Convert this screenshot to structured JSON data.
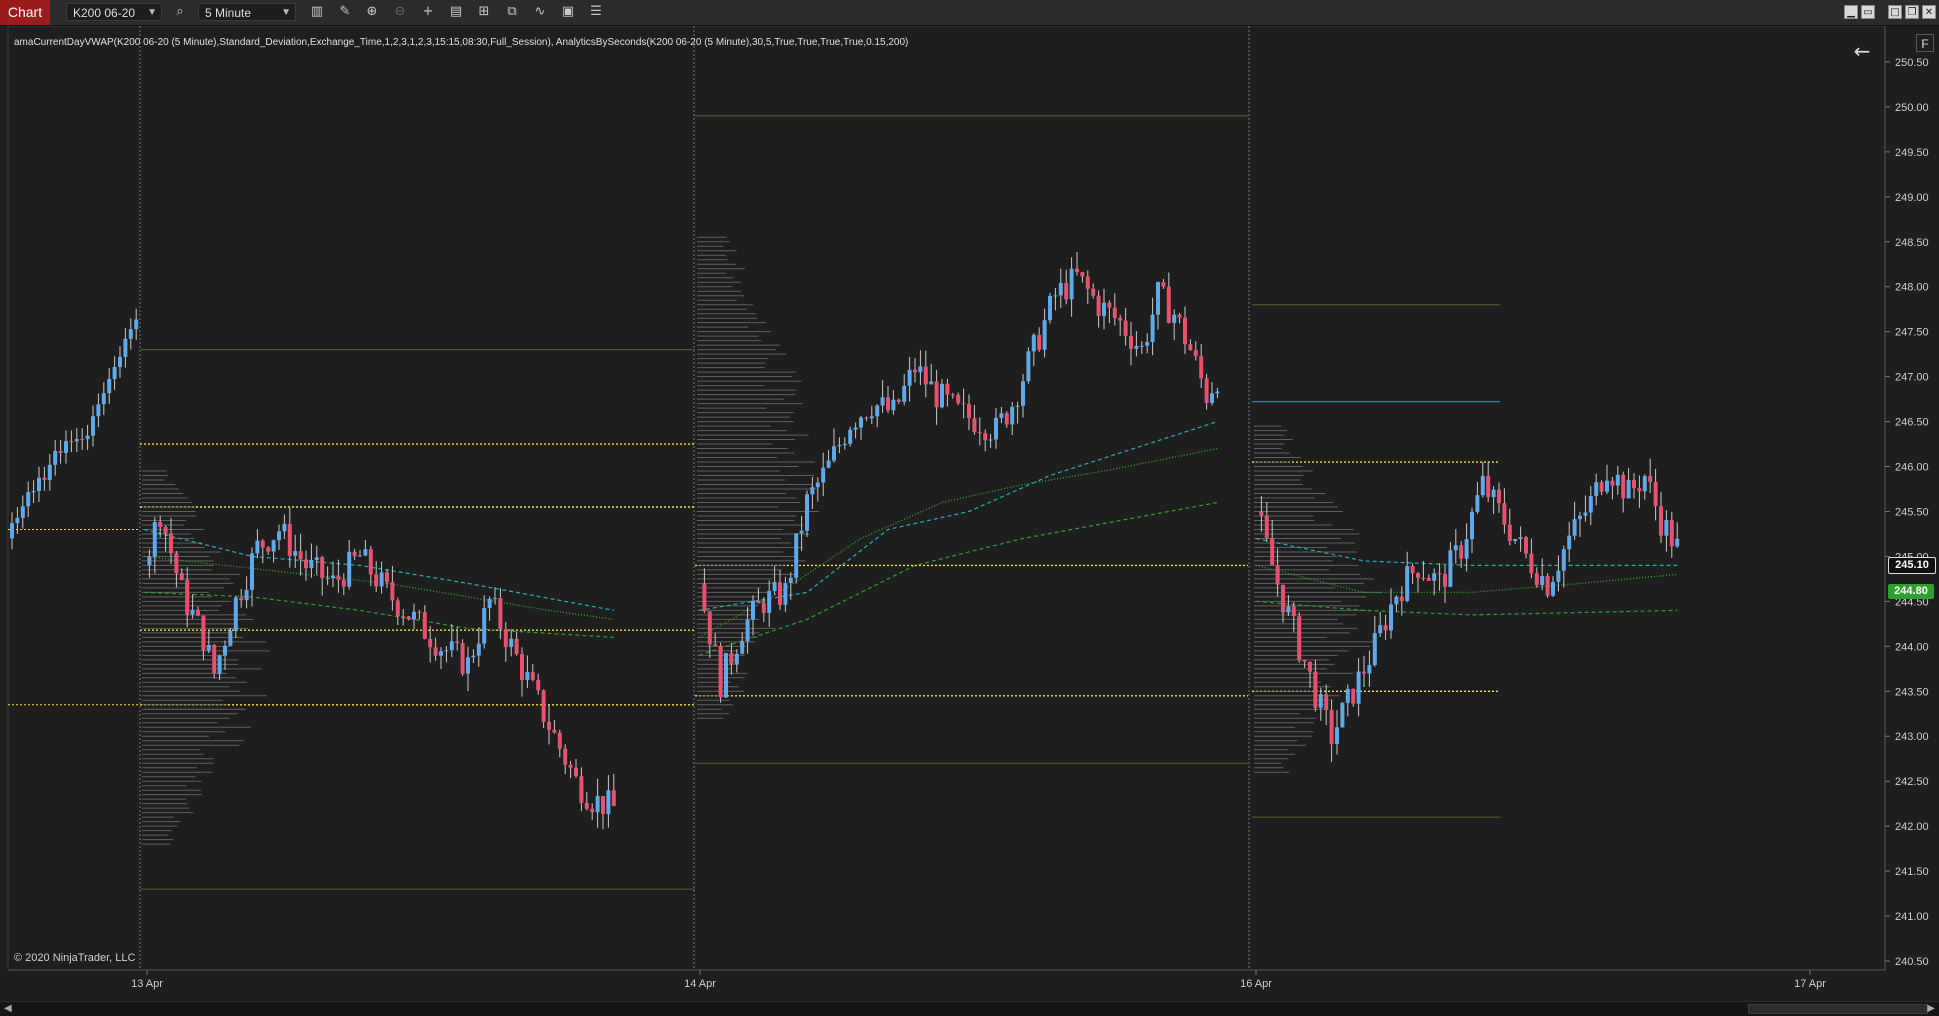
{
  "toolbar": {
    "tab_label": "Chart",
    "instrument": "K200 06-20",
    "interval": "5 Minute",
    "icons": [
      "search-icon",
      "bar-type-icon",
      "draw-pencil-icon",
      "zoom-in-icon",
      "zoom-out-icon",
      "crosshair-icon",
      "properties-icon",
      "data-box-icon",
      "strategy-icon",
      "indicators-icon",
      "templates-icon",
      "list-icon"
    ],
    "window_controls": [
      "minimize-icon",
      "restore-icon",
      "maximize-icon",
      "close-icon"
    ]
  },
  "indicator_label": "amaCurrentDayVWAP(K200 06-20 (5 Minute),Standard_Deviation,Exchange_Time,1,2,3,1,2,3,15:15,08:30,Full_Session), AnalyticsBySeconds(K200 06-20 (5 Minute),30,5,True,True,True,True,0.15,200)",
  "copyright": "© 2020 NinjaTrader, LLC",
  "f_button": "F",
  "colors": {
    "background": "#1e1e1e",
    "up_candle": "#5da9e9",
    "down_candle": "#e8506e",
    "vwap": "#2fa12f",
    "bands_dashed": "#1fb0b0",
    "day_levels": "#f2e23a",
    "volume_profile": "#6a6a6a",
    "tag_last": "#101010",
    "tag_vwap": "#2ea02e"
  },
  "price_axis": {
    "labels": [
      "250.50",
      "250.00",
      "249.50",
      "249.00",
      "248.50",
      "248.00",
      "247.50",
      "247.00",
      "246.50",
      "246.00",
      "245.50",
      "245.00",
      "244.50",
      "244.00",
      "243.50",
      "243.00",
      "242.50",
      "242.00",
      "241.50",
      "241.00",
      "240.50"
    ],
    "tags": [
      {
        "text": "245.10",
        "kind": "last"
      },
      {
        "text": "244.80",
        "kind": "vwap"
      }
    ]
  },
  "time_axis": {
    "labels": [
      "13 Apr",
      "14 Apr",
      "16 Apr",
      "17 Apr"
    ]
  },
  "chart_data": {
    "type": "candlestick",
    "instrument": "K200 06-20",
    "interval": "5 Minute",
    "ylim": [
      240.4,
      250.9
    ],
    "sessions": [
      {
        "label": "13 Apr",
        "start": 244.9,
        "path": [
          [
            0,
            244.9
          ],
          [
            3,
            245.5
          ],
          [
            7,
            244.6
          ],
          [
            11,
            244.1
          ],
          [
            13,
            243.7
          ],
          [
            17,
            244.5
          ],
          [
            21,
            245.1
          ],
          [
            25,
            245.3
          ],
          [
            30,
            244.9
          ],
          [
            35,
            244.7
          ],
          [
            40,
            245.0
          ],
          [
            45,
            244.6
          ],
          [
            50,
            244.3
          ],
          [
            55,
            244.0
          ],
          [
            60,
            243.8
          ],
          [
            64,
            244.5
          ],
          [
            68,
            244.0
          ],
          [
            72,
            243.5
          ],
          [
            76,
            243.0
          ],
          [
            80,
            242.5
          ],
          [
            83,
            242.3
          ],
          [
            87,
            242.2
          ]
        ],
        "vwap_points": [
          [
            0,
            245.0
          ],
          [
            15,
            244.9
          ],
          [
            30,
            244.8
          ],
          [
            45,
            244.7
          ],
          [
            60,
            244.55
          ],
          [
            75,
            244.4
          ],
          [
            87,
            244.3
          ]
        ],
        "bands": [
          {
            "name": "upper",
            "points": [
              [
                0,
                245.3
              ],
              [
                20,
                245.0
              ],
              [
                40,
                244.9
              ],
              [
                60,
                244.7
              ],
              [
                87,
                244.4
              ]
            ]
          },
          {
            "name": "lower",
            "points": [
              [
                0,
                244.6
              ],
              [
                20,
                244.55
              ],
              [
                40,
                244.4
              ],
              [
                60,
                244.2
              ],
              [
                87,
                244.1
              ]
            ]
          }
        ],
        "levels": [
          246.25,
          245.55,
          244.18,
          243.35
        ]
      },
      {
        "label": "14 Apr",
        "start": 244.7,
        "path": [
          [
            0,
            244.7
          ],
          [
            4,
            243.6
          ],
          [
            8,
            244.2
          ],
          [
            12,
            244.5
          ],
          [
            16,
            244.6
          ],
          [
            20,
            245.6
          ],
          [
            24,
            246.0
          ],
          [
            28,
            246.5
          ],
          [
            32,
            246.7
          ],
          [
            36,
            246.6
          ],
          [
            40,
            247.1
          ],
          [
            44,
            246.8
          ],
          [
            48,
            246.6
          ],
          [
            52,
            246.5
          ],
          [
            55,
            246.4
          ],
          [
            58,
            246.7
          ],
          [
            62,
            247.3
          ],
          [
            66,
            247.9
          ],
          [
            70,
            248.1
          ],
          [
            74,
            247.8
          ],
          [
            78,
            247.6
          ],
          [
            82,
            247.3
          ],
          [
            85,
            247.9
          ],
          [
            88,
            247.7
          ],
          [
            91,
            247.3
          ],
          [
            94,
            246.8
          ],
          [
            96,
            247.0
          ]
        ],
        "vwap_points": [
          [
            0,
            244.1
          ],
          [
            15,
            244.6
          ],
          [
            30,
            245.2
          ],
          [
            45,
            245.6
          ],
          [
            60,
            245.8
          ],
          [
            75,
            245.95
          ],
          [
            96,
            246.2
          ]
        ],
        "bands": [
          {
            "name": "upper",
            "points": [
              [
                0,
                244.4
              ],
              [
                20,
                244.6
              ],
              [
                35,
                245.3
              ],
              [
                50,
                245.5
              ],
              [
                65,
                245.9
              ],
              [
                96,
                246.5
              ]
            ]
          },
          {
            "name": "lower",
            "points": [
              [
                0,
                243.9
              ],
              [
                20,
                244.3
              ],
              [
                40,
                244.9
              ],
              [
                60,
                245.2
              ],
              [
                96,
                245.6
              ]
            ]
          }
        ],
        "levels": [
          244.9,
          243.45
        ]
      },
      {
        "label": "16 Apr",
        "start": 245.5,
        "path": [
          [
            0,
            245.5
          ],
          [
            4,
            244.7
          ],
          [
            8,
            244.0
          ],
          [
            12,
            243.3
          ],
          [
            14,
            243.0
          ],
          [
            18,
            243.5
          ],
          [
            22,
            244.0
          ],
          [
            26,
            244.6
          ],
          [
            30,
            244.9
          ],
          [
            34,
            244.7
          ],
          [
            38,
            245.1
          ],
          [
            42,
            245.8
          ],
          [
            46,
            245.4
          ],
          [
            50,
            245.0
          ],
          [
            54,
            244.7
          ],
          [
            58,
            245.2
          ],
          [
            62,
            245.6
          ],
          [
            65,
            246.0
          ],
          [
            69,
            245.7
          ],
          [
            72,
            245.9
          ],
          [
            75,
            245.4
          ],
          [
            78,
            245.1
          ]
        ],
        "vwap_points": [
          [
            0,
            244.9
          ],
          [
            20,
            244.6
          ],
          [
            40,
            244.6
          ],
          [
            60,
            244.7
          ],
          [
            78,
            244.8
          ]
        ],
        "bands": [
          {
            "name": "upper",
            "points": [
              [
                0,
                245.2
              ],
              [
                20,
                244.95
              ],
              [
                40,
                244.9
              ],
              [
                78,
                244.9
              ]
            ]
          },
          {
            "name": "lower",
            "points": [
              [
                0,
                244.5
              ],
              [
                20,
                244.4
              ],
              [
                40,
                244.35
              ],
              [
                78,
                244.4
              ]
            ]
          }
        ],
        "levels": [
          246.05,
          243.5
        ]
      }
    ]
  }
}
